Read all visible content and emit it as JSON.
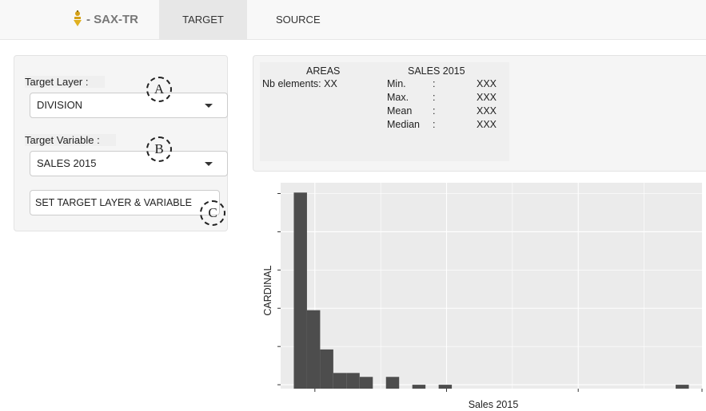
{
  "navbar": {
    "brand": "- SAX-TR",
    "tabs": [
      {
        "label": "TARGET",
        "active": true
      },
      {
        "label": "SOURCE",
        "active": false
      }
    ]
  },
  "left_panel": {
    "target_layer_label": "Target Layer :",
    "target_layer_value": "DIVISION",
    "target_variable_label": "Target Variable :",
    "target_variable_value": "SALES 2015",
    "set_button_label": "SET TARGET LAYER & VARIABLE",
    "markers": [
      "A",
      "B",
      "C"
    ]
  },
  "stats": {
    "areas_header": "AREAS",
    "nb_elements": "Nb elements: XX",
    "sales_header": "SALES 2015",
    "rows": [
      {
        "label": "Min.",
        "sep": ":",
        "value": "XXX"
      },
      {
        "label": "Max.",
        "sep": ":",
        "value": "XXX"
      },
      {
        "label": "Mean",
        "sep": ":",
        "value": "XXX"
      },
      {
        "label": "Median",
        "sep": ":",
        "value": "XXX"
      }
    ]
  },
  "colors": {
    "bar": "#4d4d4d",
    "panel_bg": "#ebebeb",
    "grid": "#ffffff",
    "brand_icon": "#d4a017"
  },
  "chart_data": {
    "type": "bar",
    "xlabel": "Sales 2015",
    "ylabel": "CARDINAL",
    "grid": true,
    "note": "histogram; axis tick labels not shown",
    "bins": [
      {
        "bin": 1,
        "count": 100
      },
      {
        "bin": 2,
        "count": 40
      },
      {
        "bin": 3,
        "count": 20
      },
      {
        "bin": 4,
        "count": 8
      },
      {
        "bin": 5,
        "count": 8
      },
      {
        "bin": 6,
        "count": 6
      },
      {
        "bin": 8,
        "count": 6
      },
      {
        "bin": 10,
        "count": 2
      },
      {
        "bin": 12,
        "count": 2
      },
      {
        "bin": 30,
        "count": 2
      }
    ],
    "xlim": [
      0,
      32
    ],
    "ylim": [
      0,
      105
    ]
  }
}
